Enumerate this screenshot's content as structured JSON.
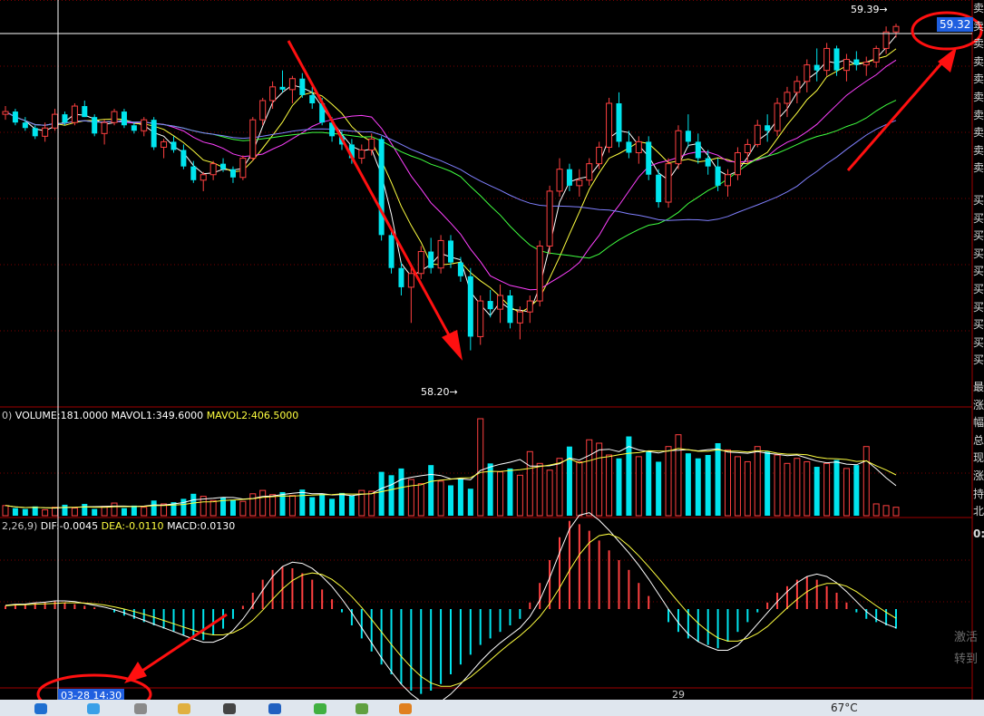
{
  "chart_data": {
    "type": "candlestick",
    "price_axis": {
      "ylim": [
        58.05,
        59.45
      ]
    },
    "annotations": {
      "high_label": "59.39",
      "low_label": "58.20",
      "current_price": "59.32",
      "time_cursor": "03-28 14:30",
      "date_mark": "29"
    },
    "candles": [
      [
        59.06,
        59.09,
        59.04,
        59.07
      ],
      [
        59.07,
        59.08,
        59.02,
        59.03
      ],
      [
        59.03,
        59.05,
        59.0,
        59.01
      ],
      [
        59.01,
        59.02,
        58.97,
        58.98
      ],
      [
        58.98,
        59.03,
        58.96,
        59.01
      ],
      [
        59.01,
        59.08,
        59.0,
        59.06
      ],
      [
        59.06,
        59.07,
        59.02,
        59.03
      ],
      [
        59.03,
        59.1,
        59.02,
        59.09
      ],
      [
        59.09,
        59.11,
        59.05,
        59.05
      ],
      [
        59.05,
        59.06,
        58.98,
        58.99
      ],
      [
        58.99,
        59.04,
        58.95,
        59.03
      ],
      [
        59.03,
        59.08,
        59.02,
        59.07
      ],
      [
        59.07,
        59.08,
        59.01,
        59.02
      ],
      [
        59.02,
        59.03,
        58.99,
        59.0
      ],
      [
        59.0,
        59.05,
        58.98,
        59.04
      ],
      [
        59.04,
        59.05,
        58.93,
        58.94
      ],
      [
        58.94,
        58.97,
        58.9,
        58.96
      ],
      [
        58.96,
        58.98,
        58.92,
        58.93
      ],
      [
        58.93,
        58.95,
        58.86,
        58.87
      ],
      [
        58.87,
        58.89,
        58.81,
        58.82
      ],
      [
        58.82,
        58.85,
        58.78,
        58.84
      ],
      [
        58.84,
        58.89,
        58.82,
        58.88
      ],
      [
        58.88,
        58.9,
        58.85,
        58.86
      ],
      [
        58.86,
        58.87,
        58.81,
        58.83
      ],
      [
        58.83,
        58.91,
        58.82,
        58.9
      ],
      [
        58.9,
        59.05,
        58.89,
        59.04
      ],
      [
        59.04,
        59.12,
        59.02,
        59.11
      ],
      [
        59.11,
        59.18,
        59.08,
        59.16
      ],
      [
        59.16,
        59.22,
        59.14,
        59.15
      ],
      [
        59.15,
        59.2,
        59.1,
        59.19
      ],
      [
        59.19,
        59.21,
        59.12,
        59.13
      ],
      [
        59.13,
        59.16,
        59.08,
        59.1
      ],
      [
        59.1,
        59.12,
        59.02,
        59.03
      ],
      [
        59.03,
        59.05,
        58.96,
        58.98
      ],
      [
        58.98,
        59.0,
        58.93,
        58.95
      ],
      [
        58.95,
        58.97,
        58.88,
        58.9
      ],
      [
        58.9,
        58.95,
        58.88,
        58.93
      ],
      [
        58.93,
        58.99,
        58.91,
        58.97
      ],
      [
        58.97,
        58.98,
        58.6,
        58.62
      ],
      [
        58.62,
        58.64,
        58.48,
        58.5
      ],
      [
        58.5,
        58.52,
        58.4,
        58.43
      ],
      [
        58.43,
        58.5,
        58.3,
        58.48
      ],
      [
        58.48,
        58.58,
        58.46,
        58.56
      ],
      [
        58.56,
        58.61,
        58.48,
        58.5
      ],
      [
        58.5,
        58.62,
        58.48,
        58.6
      ],
      [
        58.6,
        58.62,
        58.5,
        58.52
      ],
      [
        58.52,
        58.54,
        58.45,
        58.47
      ],
      [
        58.47,
        58.5,
        58.2,
        58.25
      ],
      [
        58.25,
        58.4,
        58.22,
        58.38
      ],
      [
        58.38,
        58.42,
        58.32,
        58.35
      ],
      [
        58.35,
        58.44,
        58.3,
        58.4
      ],
      [
        58.4,
        58.42,
        58.28,
        58.3
      ],
      [
        58.3,
        58.36,
        58.24,
        58.34
      ],
      [
        58.34,
        58.4,
        58.3,
        58.38
      ],
      [
        58.38,
        58.6,
        58.36,
        58.58
      ],
      [
        58.58,
        58.8,
        58.55,
        58.78
      ],
      [
        58.78,
        58.9,
        58.76,
        58.86
      ],
      [
        58.86,
        58.88,
        58.78,
        58.8
      ],
      [
        58.8,
        58.86,
        58.76,
        58.82
      ],
      [
        58.82,
        58.9,
        58.8,
        58.88
      ],
      [
        58.88,
        58.96,
        58.86,
        58.94
      ],
      [
        58.94,
        59.12,
        58.92,
        59.1
      ],
      [
        59.1,
        59.14,
        58.94,
        58.96
      ],
      [
        58.96,
        59.0,
        58.9,
        58.92
      ],
      [
        58.92,
        58.98,
        58.88,
        58.96
      ],
      [
        58.96,
        58.98,
        58.82,
        58.84
      ],
      [
        58.84,
        58.86,
        58.72,
        58.74
      ],
      [
        58.74,
        58.9,
        58.72,
        58.88
      ],
      [
        58.88,
        59.02,
        58.86,
        59.0
      ],
      [
        59.0,
        59.06,
        58.94,
        58.96
      ],
      [
        58.96,
        58.99,
        58.88,
        58.9
      ],
      [
        58.9,
        58.93,
        58.84,
        58.87
      ],
      [
        58.87,
        58.9,
        58.78,
        58.8
      ],
      [
        58.8,
        58.86,
        58.76,
        58.84
      ],
      [
        58.84,
        58.94,
        58.82,
        58.92
      ],
      [
        58.92,
        58.97,
        58.88,
        58.95
      ],
      [
        58.95,
        59.04,
        58.94,
        59.02
      ],
      [
        59.02,
        59.06,
        58.96,
        59.0
      ],
      [
        59.0,
        59.12,
        58.98,
        59.1
      ],
      [
        59.1,
        59.16,
        59.05,
        59.14
      ],
      [
        59.14,
        59.2,
        59.1,
        59.18
      ],
      [
        59.18,
        59.26,
        59.14,
        59.24
      ],
      [
        59.24,
        59.3,
        59.18,
        59.22
      ],
      [
        59.22,
        59.32,
        59.2,
        59.3
      ],
      [
        59.3,
        59.31,
        59.2,
        59.22
      ],
      [
        59.22,
        59.28,
        59.18,
        59.26
      ],
      [
        59.26,
        59.29,
        59.22,
        59.24
      ],
      [
        59.24,
        59.27,
        59.2,
        59.25
      ],
      [
        59.25,
        59.31,
        59.23,
        59.3
      ],
      [
        59.3,
        59.38,
        59.28,
        59.36
      ],
      [
        59.36,
        59.39,
        59.34,
        59.38
      ]
    ],
    "volume": {
      "label": "VOLUME:181.0000",
      "mavol1_label": "MAVOL1:349.6000",
      "mavol2_label": "MAVOL2:406.5000",
      "prefix": "0)",
      "values": [
        120,
        90,
        80,
        110,
        70,
        100,
        130,
        90,
        140,
        80,
        110,
        150,
        90,
        120,
        100,
        180,
        140,
        160,
        200,
        260,
        230,
        180,
        220,
        190,
        170,
        260,
        300,
        250,
        280,
        240,
        310,
        220,
        260,
        200,
        270,
        240,
        300,
        290,
        520,
        480,
        560,
        430,
        380,
        600,
        410,
        360,
        440,
        320,
        1150,
        620,
        520,
        560,
        480,
        760,
        620,
        540,
        680,
        820,
        640,
        900,
        860,
        720,
        680,
        940,
        700,
        760,
        640,
        820,
        960,
        740,
        680,
        720,
        860,
        780,
        700,
        640,
        820,
        760,
        720,
        620,
        680,
        640,
        580,
        620,
        660,
        560,
        600,
        820,
        140,
        120,
        100
      ]
    },
    "macd": {
      "prefix": "2,26,9)",
      "dif_label": "DIF:-0.0045",
      "dea_label": "DEA:-0.0110",
      "macd_label": "MACD:0.0130",
      "values": [
        0.002,
        0.003,
        0.003,
        0.004,
        0.004,
        0.005,
        0.004,
        0.003,
        0.002,
        0.001,
        0,
        -0.002,
        -0.004,
        -0.006,
        -0.008,
        -0.01,
        -0.012,
        -0.014,
        -0.016,
        -0.018,
        -0.019,
        -0.016,
        -0.012,
        -0.006,
        0.002,
        0.01,
        0.018,
        0.024,
        0.026,
        0.025,
        0.022,
        0.018,
        0.012,
        0.006,
        -0.002,
        -0.01,
        -0.018,
        -0.026,
        -0.034,
        -0.04,
        -0.046,
        -0.05,
        -0.052,
        -0.05,
        -0.046,
        -0.04,
        -0.034,
        -0.028,
        -0.022,
        -0.018,
        -0.014,
        -0.01,
        -0.006,
        0.004,
        0.016,
        0.03,
        0.044,
        0.054,
        0.052,
        0.048,
        0.042,
        0.036,
        0.03,
        0.024,
        0.016,
        0.008,
        0,
        -0.008,
        -0.014,
        -0.018,
        -0.02,
        -0.022,
        -0.024,
        -0.02,
        -0.014,
        -0.008,
        -0.002,
        0.004,
        0.01,
        0.014,
        0.018,
        0.02,
        0.018,
        0.014,
        0.01,
        0.004,
        -0.002,
        -0.006,
        -0.008,
        -0.01,
        -0.012
      ]
    },
    "colors": {
      "up": "#ff4040",
      "down": "#00e5ee",
      "ma1": "#ffffff",
      "ma2": "#ffff40",
      "ma3": "#ff40ff",
      "ma4": "#40ff40",
      "ma5": "#8080ff",
      "dea": "#ffff40",
      "annotation": "#ff1010",
      "grid": "#7a0000"
    }
  },
  "sidebar": {
    "upper": [
      "卖",
      "卖",
      "卖",
      "卖",
      "卖",
      "卖",
      "卖",
      "卖",
      "卖",
      "卖"
    ],
    "lower": [
      "买",
      "买",
      "买",
      "买",
      "买",
      "买",
      "买",
      "买",
      "买",
      "买"
    ],
    "stats": [
      "最",
      "涨",
      "幅",
      "总",
      "现",
      "涨",
      "持",
      "北"
    ],
    "extra": [
      "0:"
    ]
  },
  "watermark": {
    "line1": "激活",
    "line2": "转到"
  },
  "status": {
    "temperature": "67°C"
  }
}
